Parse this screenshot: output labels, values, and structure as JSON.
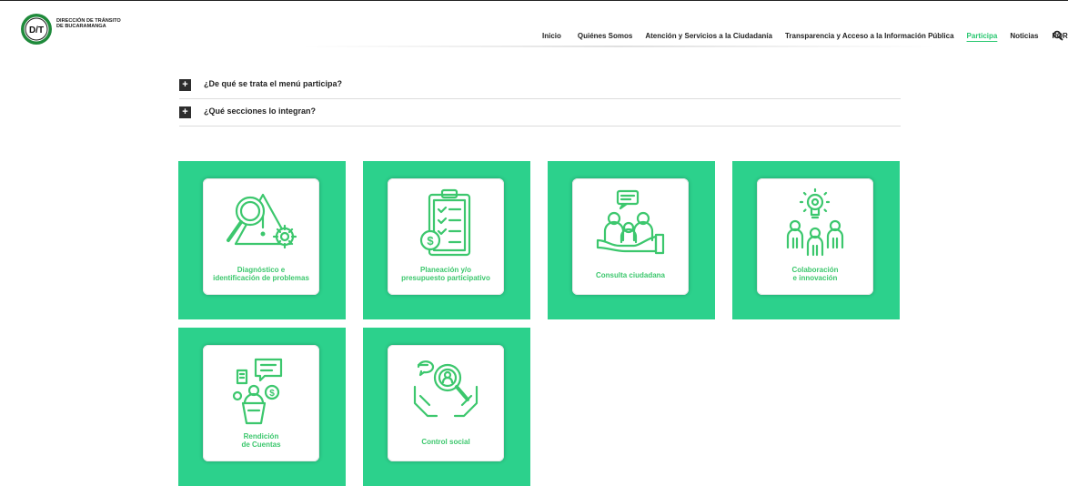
{
  "brand": {
    "logo_letters": "D/T",
    "name_line1": "DIRECCIÓN DE TRÁNSITO",
    "name_line2": "DE BUCARAMANGA"
  },
  "nav": {
    "items": [
      "Inicio",
      "Quiénes Somos",
      "Atención y Servicios a la Ciudadanía",
      "Transparencia y Acceso a la Información Pública",
      "Participa",
      "Noticias",
      "PQRS"
    ],
    "active": "Participa"
  },
  "faq": [
    {
      "symbol": "+",
      "question": "¿De qué se trata el menú participa?"
    },
    {
      "symbol": "+",
      "question": "¿Qué secciones lo integran?"
    }
  ],
  "cards": [
    {
      "label": "Diagnóstico e\nidentificación de problemas",
      "icon": "magnifier-warning-icon"
    },
    {
      "label": "Planeación y/o\npresupuesto participativo",
      "icon": "clipboard-money-icon"
    },
    {
      "label": "Consulta ciudadana",
      "icon": "community-hand-icon"
    },
    {
      "label": "Colaboración\ne innovación",
      "icon": "lightbulb-team-icon"
    },
    {
      "label": "Rendición\nde Cuentas",
      "icon": "speaker-podium-icon"
    },
    {
      "label": "Control social",
      "icon": "hands-magnifier-icon"
    }
  ],
  "colors": {
    "accent": "#2cd18c",
    "icon_green": "#3cc76d",
    "nav_active": "#28c76f",
    "plus_box": "#2d2d2d"
  }
}
